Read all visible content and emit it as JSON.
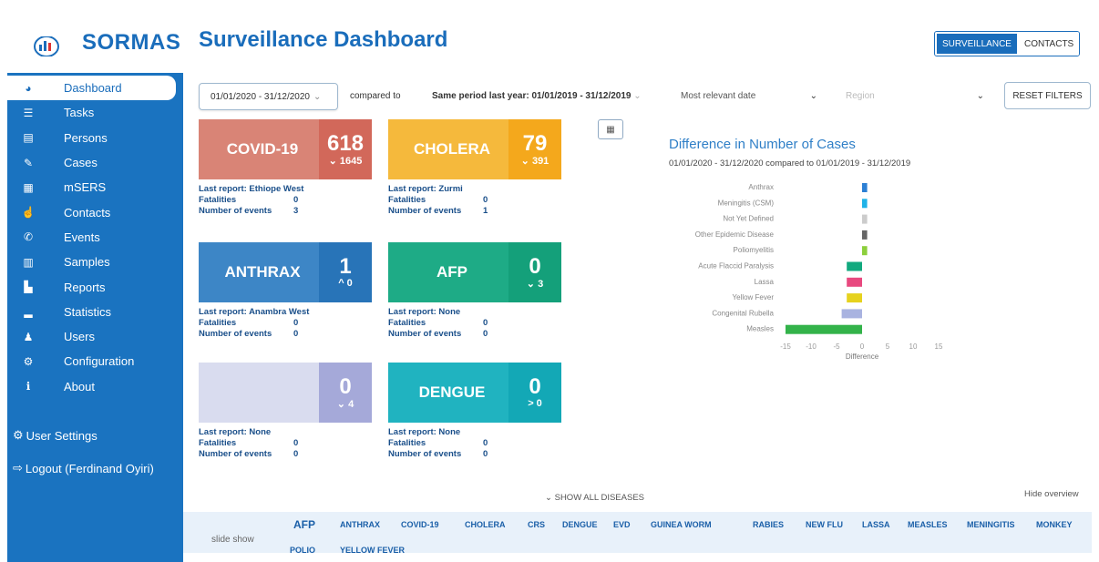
{
  "brand": {
    "name": "SORMAS"
  },
  "sidebar": {
    "items": [
      {
        "label": "Dashboard",
        "icon": "dashboard-icon",
        "glyph": "◕",
        "active": true
      },
      {
        "label": "Tasks",
        "icon": "tasks-icon",
        "glyph": "☰"
      },
      {
        "label": "Persons",
        "icon": "persons-icon",
        "glyph": "▤"
      },
      {
        "label": "Cases",
        "icon": "cases-icon",
        "glyph": "✎"
      },
      {
        "label": "mSERS",
        "icon": "msers-icon",
        "glyph": "▦"
      },
      {
        "label": "Contacts",
        "icon": "contacts-icon",
        "glyph": "☝"
      },
      {
        "label": "Events",
        "icon": "events-icon",
        "glyph": "✆"
      },
      {
        "label": "Samples",
        "icon": "samples-icon",
        "glyph": "▥"
      },
      {
        "label": "Reports",
        "icon": "reports-icon",
        "glyph": "▙"
      },
      {
        "label": "Statistics",
        "icon": "statistics-icon",
        "glyph": "▂"
      },
      {
        "label": "Users",
        "icon": "users-icon",
        "glyph": "♟"
      },
      {
        "label": "Configuration",
        "icon": "configuration-icon",
        "glyph": "⚙"
      },
      {
        "label": "About",
        "icon": "about-icon",
        "glyph": "ℹ"
      }
    ],
    "user_settings": "User Settings",
    "logout": "Logout (Ferdinand Oyiri)"
  },
  "header": {
    "title": "Surveillance Dashboard",
    "toggle": [
      "SURVEILLANCE",
      "CONTACTS"
    ]
  },
  "filters": {
    "date_range": "01/01/2020 - 31/12/2020",
    "compared_to": "compared to",
    "same_period": "Same period last year: 01/01/2019 - 31/12/2019",
    "date_type": "Most relevant date",
    "region": "Region",
    "reset": "RESET FILTERS"
  },
  "cards": [
    {
      "name": "COVID-19",
      "count": "618",
      "delta": "⌄ 1645",
      "color_name": "#d98476",
      "color_num": "#d2685a",
      "last_report": "Last report: Ethiope West",
      "fatalities": "0",
      "events": "3"
    },
    {
      "name": "CHOLERA",
      "count": "79",
      "delta": "⌄ 391",
      "color_name": "#f5b93c",
      "color_num": "#f4a81c",
      "last_report": "Last report: Zurmi",
      "fatalities": "0",
      "events": "1"
    },
    {
      "name": "ANTHRAX",
      "count": "1",
      "delta": "^ 0",
      "color_name": "#3d86c6",
      "color_num": "#2874b8",
      "last_report": "Last report: Anambra West",
      "fatalities": "0",
      "events": "0"
    },
    {
      "name": "AFP",
      "count": "0",
      "delta": "⌄ 3",
      "color_name": "#1eab86",
      "color_num": "#14a07a",
      "last_report": "Last report: None",
      "fatalities": "0",
      "events": "0"
    },
    {
      "name": "",
      "count": "0",
      "delta": "⌄ 4",
      "color_name": "#d9dcef",
      "color_num": "#a5a9d9",
      "last_report": "Last report: None",
      "fatalities": "0",
      "events": "0"
    },
    {
      "name": "DENGUE",
      "count": "0",
      "delta": "> 0",
      "color_name": "#20b3c0",
      "color_num": "#13a8b6",
      "last_report": "Last report: None",
      "fatalities": "0",
      "events": "0"
    }
  ],
  "card_labels": {
    "fatalities": "Fatalities",
    "events": "Number of events"
  },
  "chart_data": {
    "type": "bar",
    "orientation": "horizontal",
    "title": "Difference in Number of Cases",
    "subtitle": "01/01/2020 - 31/12/2020 compared to 01/01/2019 - 31/12/2019",
    "categories": [
      "Anthrax",
      "Meningitis (CSM)",
      "Not Yet Defined",
      "Other Epidemic Disease",
      "Poliomyelitis",
      "Acute Flaccid Paralysis",
      "Lassa",
      "Yellow Fever",
      "Congenital Rubella",
      "Measles"
    ],
    "values": [
      1,
      1,
      1,
      1,
      1,
      -3,
      -3,
      -3,
      -4,
      -15
    ],
    "colors": [
      "#2c7fd4",
      "#1fb3e8",
      "#cccccc",
      "#666666",
      "#8ccf3c",
      "#12a97e",
      "#e8497f",
      "#e6d21e",
      "#a9b3e0",
      "#33b34a"
    ],
    "xlabel": "Difference",
    "xlim": [
      -15,
      15
    ],
    "xticks": [
      -15,
      -10,
      -5,
      0,
      5,
      10,
      15
    ]
  },
  "bottom": {
    "show_all": "SHOW ALL DISEASES",
    "hide_overview": "Hide overview",
    "slide_show": "slide show",
    "tabs": [
      "AFP",
      "ANTHRAX",
      "COVID-19",
      "CHOLERA",
      "CRS",
      "DENGUE",
      "EVD",
      "GUINEA WORM",
      "RABIES",
      "NEW FLU",
      "LASSA",
      "MEASLES",
      "MENINGITIS",
      "MONKEY",
      "POLIO",
      "YELLOW FEVER"
    ]
  }
}
